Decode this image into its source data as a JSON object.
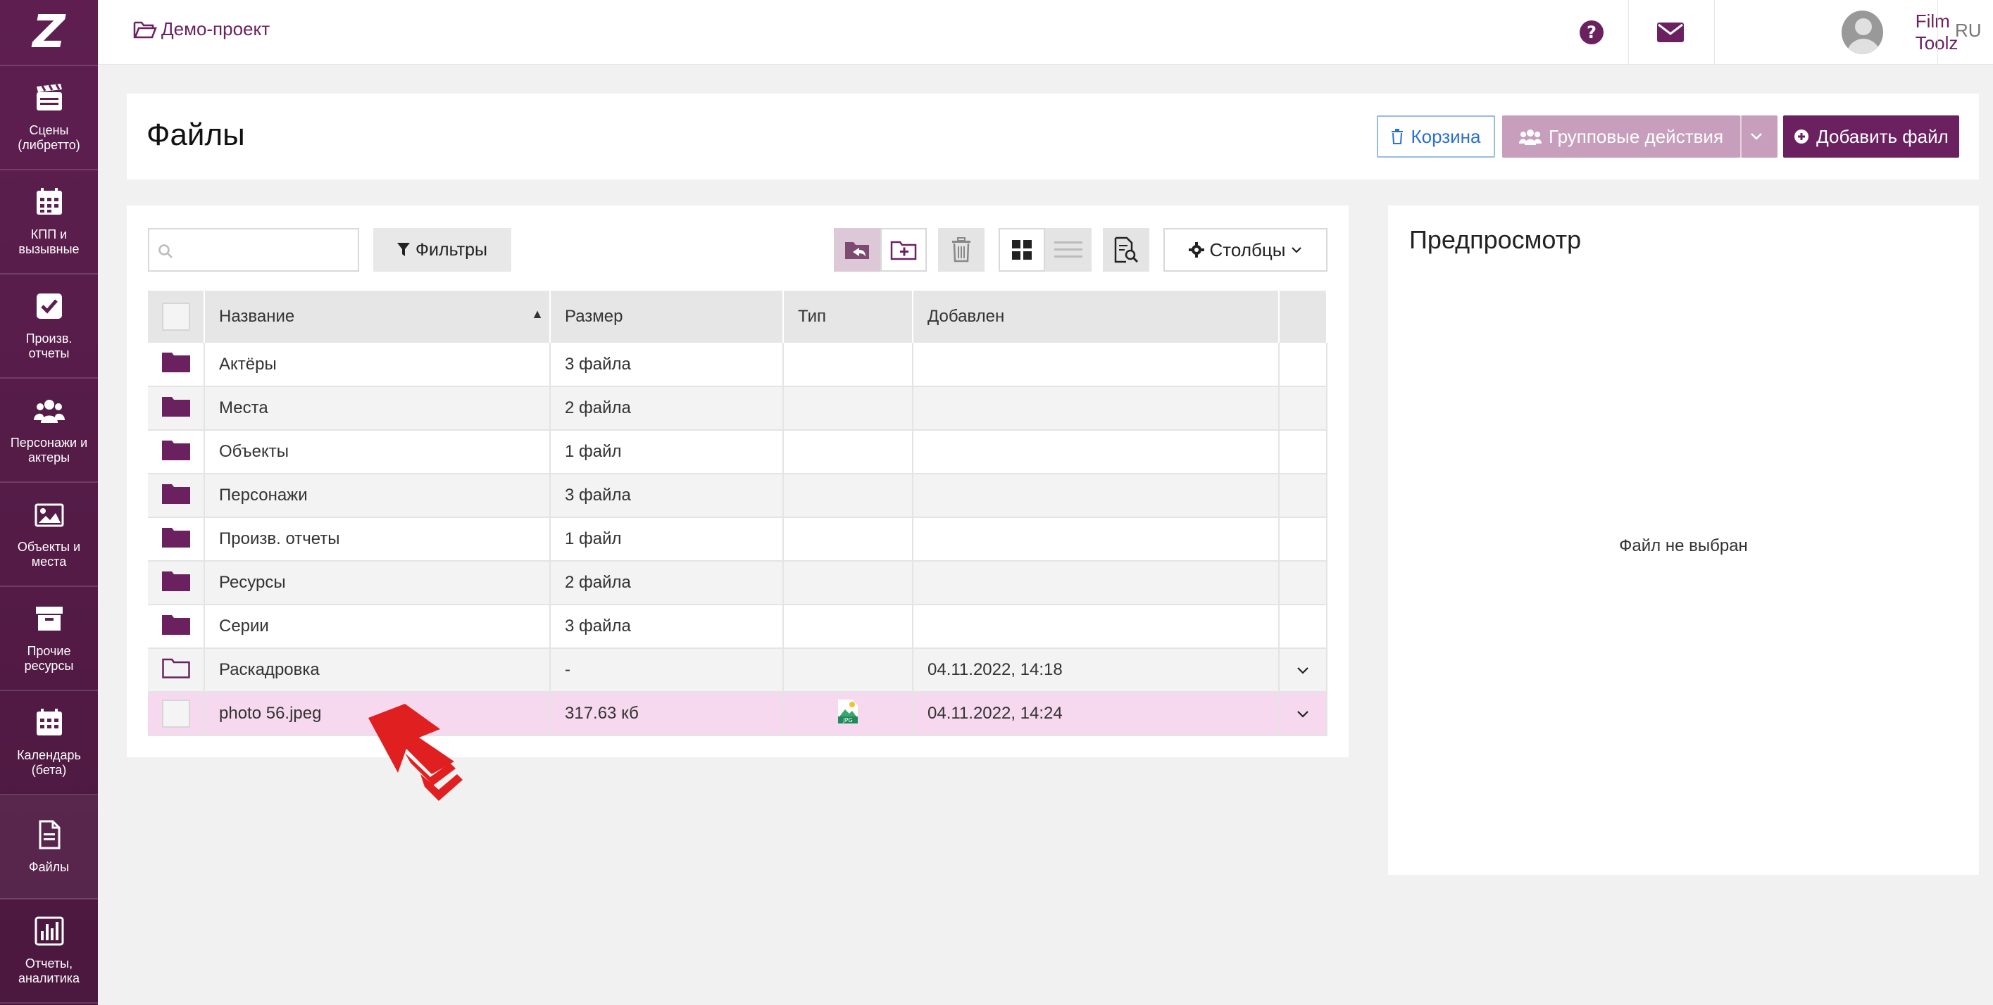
{
  "app": {
    "logo": "Z"
  },
  "sidebar": {
    "items": [
      {
        "label": "Сцены (либретто)",
        "icon": "clapperboard-icon"
      },
      {
        "label": "КПП и вызывные",
        "icon": "calendar-grid-icon"
      },
      {
        "label": "Произв. отчеты",
        "icon": "checkbox-icon"
      },
      {
        "label": "Персонажи и актеры",
        "icon": "users-icon"
      },
      {
        "label": "Объекты и места",
        "icon": "image-icon"
      },
      {
        "label": "Прочие ресурсы",
        "icon": "archive-box-icon"
      },
      {
        "label": "Календарь (бета)",
        "icon": "calendar-icon"
      },
      {
        "label": "Файлы",
        "icon": "file-icon"
      },
      {
        "label": "Отчеты, аналитика",
        "icon": "bar-chart-icon"
      }
    ]
  },
  "topbar": {
    "project": "Демо-проект",
    "username": "Film Toolz",
    "lang": "RU"
  },
  "header": {
    "title": "Файлы",
    "trash_label": "Корзина",
    "group_actions_label": "Групповые действия",
    "add_file_label": "Добавить файл"
  },
  "toolbar": {
    "search_placeholder": "",
    "filters_label": "Фильтры",
    "columns_label": "Столбцы"
  },
  "table": {
    "headers": [
      "Название",
      "Размер",
      "Тип",
      "Добавлен"
    ],
    "rows": [
      {
        "name": "Актёры",
        "size": "3 файла",
        "type": "",
        "added": ""
      },
      {
        "name": "Места",
        "size": "2 файла",
        "type": "",
        "added": ""
      },
      {
        "name": "Объекты",
        "size": "1 файл",
        "type": "",
        "added": ""
      },
      {
        "name": "Персонажи",
        "size": "3 файла",
        "type": "",
        "added": ""
      },
      {
        "name": "Произв. отчеты",
        "size": "1 файл",
        "type": "",
        "added": ""
      },
      {
        "name": "Ресурсы",
        "size": "2 файла",
        "type": "",
        "added": ""
      },
      {
        "name": "Серии",
        "size": "3 файла",
        "type": "",
        "added": ""
      },
      {
        "name": "Раскадровка",
        "size": "-",
        "type": "",
        "added": "04.11.2022, 14:18"
      },
      {
        "name": "photo 56.jpeg",
        "size": "317.63 кб",
        "type": "JPG",
        "added": "04.11.2022, 14:24"
      }
    ]
  },
  "preview": {
    "title": "Предпросмотр",
    "empty_text": "Файл не выбран"
  },
  "colors": {
    "brand": "#6b2160",
    "sidebar": "#5e1f50",
    "selected_row": "#f6d9ef",
    "annotation_arrow": "#e02020"
  }
}
